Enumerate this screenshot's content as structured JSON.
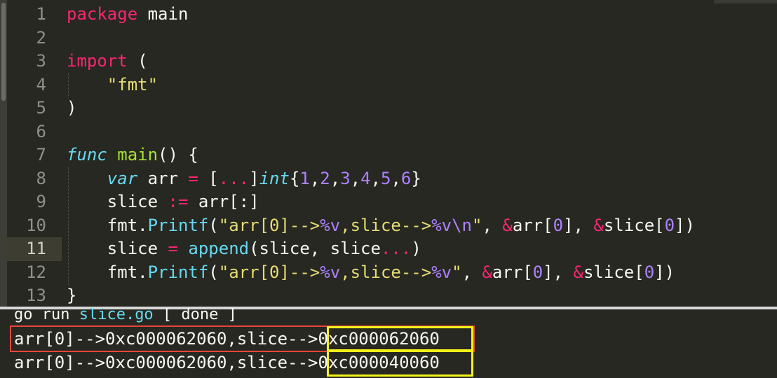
{
  "editor": {
    "current_line": 11,
    "lines": [
      {
        "n": "1",
        "tokens": [
          {
            "t": "package",
            "c": "kw"
          },
          {
            "t": " main",
            "c": ""
          }
        ]
      },
      {
        "n": "2",
        "tokens": []
      },
      {
        "n": "3",
        "tokens": [
          {
            "t": "import",
            "c": "kw"
          },
          {
            "t": " (",
            "c": ""
          }
        ]
      },
      {
        "n": "4",
        "tokens": [
          {
            "t": "    ",
            "c": ""
          },
          {
            "t": "\"fmt\"",
            "c": "st"
          }
        ]
      },
      {
        "n": "5",
        "tokens": [
          {
            "t": ")",
            "c": ""
          }
        ]
      },
      {
        "n": "6",
        "tokens": []
      },
      {
        "n": "7",
        "tokens": [
          {
            "t": "func",
            "c": "it"
          },
          {
            "t": " ",
            "c": ""
          },
          {
            "t": "main",
            "c": "fn"
          },
          {
            "t": "() {",
            "c": ""
          }
        ]
      },
      {
        "n": "8",
        "tokens": [
          {
            "t": "    ",
            "c": ""
          },
          {
            "t": "var",
            "c": "it"
          },
          {
            "t": " arr ",
            "c": ""
          },
          {
            "t": "=",
            "c": "op"
          },
          {
            "t": " [",
            "c": ""
          },
          {
            "t": "...",
            "c": "op"
          },
          {
            "t": "]",
            "c": ""
          },
          {
            "t": "int",
            "c": "it"
          },
          {
            "t": "{",
            "c": ""
          },
          {
            "t": "1",
            "c": "nu"
          },
          {
            "t": ",",
            "c": ""
          },
          {
            "t": "2",
            "c": "nu"
          },
          {
            "t": ",",
            "c": ""
          },
          {
            "t": "3",
            "c": "nu"
          },
          {
            "t": ",",
            "c": ""
          },
          {
            "t": "4",
            "c": "nu"
          },
          {
            "t": ",",
            "c": ""
          },
          {
            "t": "5",
            "c": "nu"
          },
          {
            "t": ",",
            "c": ""
          },
          {
            "t": "6",
            "c": "nu"
          },
          {
            "t": "}",
            "c": ""
          }
        ]
      },
      {
        "n": "9",
        "tokens": [
          {
            "t": "    slice ",
            "c": ""
          },
          {
            "t": ":=",
            "c": "op"
          },
          {
            "t": " arr[:]",
            "c": ""
          }
        ]
      },
      {
        "n": "10",
        "tokens": [
          {
            "t": "    fmt.",
            "c": ""
          },
          {
            "t": "Printf",
            "c": "bi"
          },
          {
            "t": "(",
            "c": ""
          },
          {
            "t": "\"arr[0]-->",
            "c": "st"
          },
          {
            "t": "%v",
            "c": "nu"
          },
          {
            "t": ",slice-->",
            "c": "st"
          },
          {
            "t": "%v",
            "c": "nu"
          },
          {
            "t": "\\n",
            "c": "nu"
          },
          {
            "t": "\"",
            "c": "st"
          },
          {
            "t": ", ",
            "c": ""
          },
          {
            "t": "&",
            "c": "op"
          },
          {
            "t": "arr[",
            "c": ""
          },
          {
            "t": "0",
            "c": "nu"
          },
          {
            "t": "], ",
            "c": ""
          },
          {
            "t": "&",
            "c": "op"
          },
          {
            "t": "slice[",
            "c": ""
          },
          {
            "t": "0",
            "c": "nu"
          },
          {
            "t": "])",
            "c": ""
          }
        ]
      },
      {
        "n": "11",
        "tokens": [
          {
            "t": "    slice ",
            "c": ""
          },
          {
            "t": "=",
            "c": "op"
          },
          {
            "t": " ",
            "c": ""
          },
          {
            "t": "append",
            "c": "bi"
          },
          {
            "t": "(slice, slice",
            "c": ""
          },
          {
            "t": "...",
            "c": "op"
          },
          {
            "t": ")",
            "c": ""
          }
        ]
      },
      {
        "n": "12",
        "tokens": [
          {
            "t": "    fmt.",
            "c": ""
          },
          {
            "t": "Printf",
            "c": "bi"
          },
          {
            "t": "(",
            "c": ""
          },
          {
            "t": "\"arr[0]-->",
            "c": "st"
          },
          {
            "t": "%v",
            "c": "nu"
          },
          {
            "t": ",slice-->",
            "c": "st"
          },
          {
            "t": "%v",
            "c": "nu"
          },
          {
            "t": "\"",
            "c": "st"
          },
          {
            "t": ", ",
            "c": ""
          },
          {
            "t": "&",
            "c": "op"
          },
          {
            "t": "arr[",
            "c": ""
          },
          {
            "t": "0",
            "c": "nu"
          },
          {
            "t": "], ",
            "c": ""
          },
          {
            "t": "&",
            "c": "op"
          },
          {
            "t": "slice[",
            "c": ""
          },
          {
            "t": "0",
            "c": "nu"
          },
          {
            "t": "])",
            "c": ""
          }
        ]
      },
      {
        "n": "13",
        "tokens": [
          {
            "t": "}",
            "c": ""
          }
        ]
      }
    ]
  },
  "terminal": {
    "command_prefix": "go run ",
    "command_file": "slice.go",
    "command_suffix": " [ done ]",
    "output_lines": [
      {
        "prefix": "arr[0]-->0xc000062060,slice--",
        "boxed": ">0xc000062060"
      },
      {
        "prefix": "arr[0]-->0xc000062060,slice--",
        "boxed": ">0xc000040060"
      }
    ]
  },
  "colors": {
    "background": "#272822",
    "keyword": "#f92672",
    "string": "#e6db74",
    "function": "#a6e22e",
    "builtin": "#66d9ef",
    "number": "#ae81ff",
    "annotation_red": "#e8463c",
    "annotation_yellow": "#f5f31a"
  }
}
